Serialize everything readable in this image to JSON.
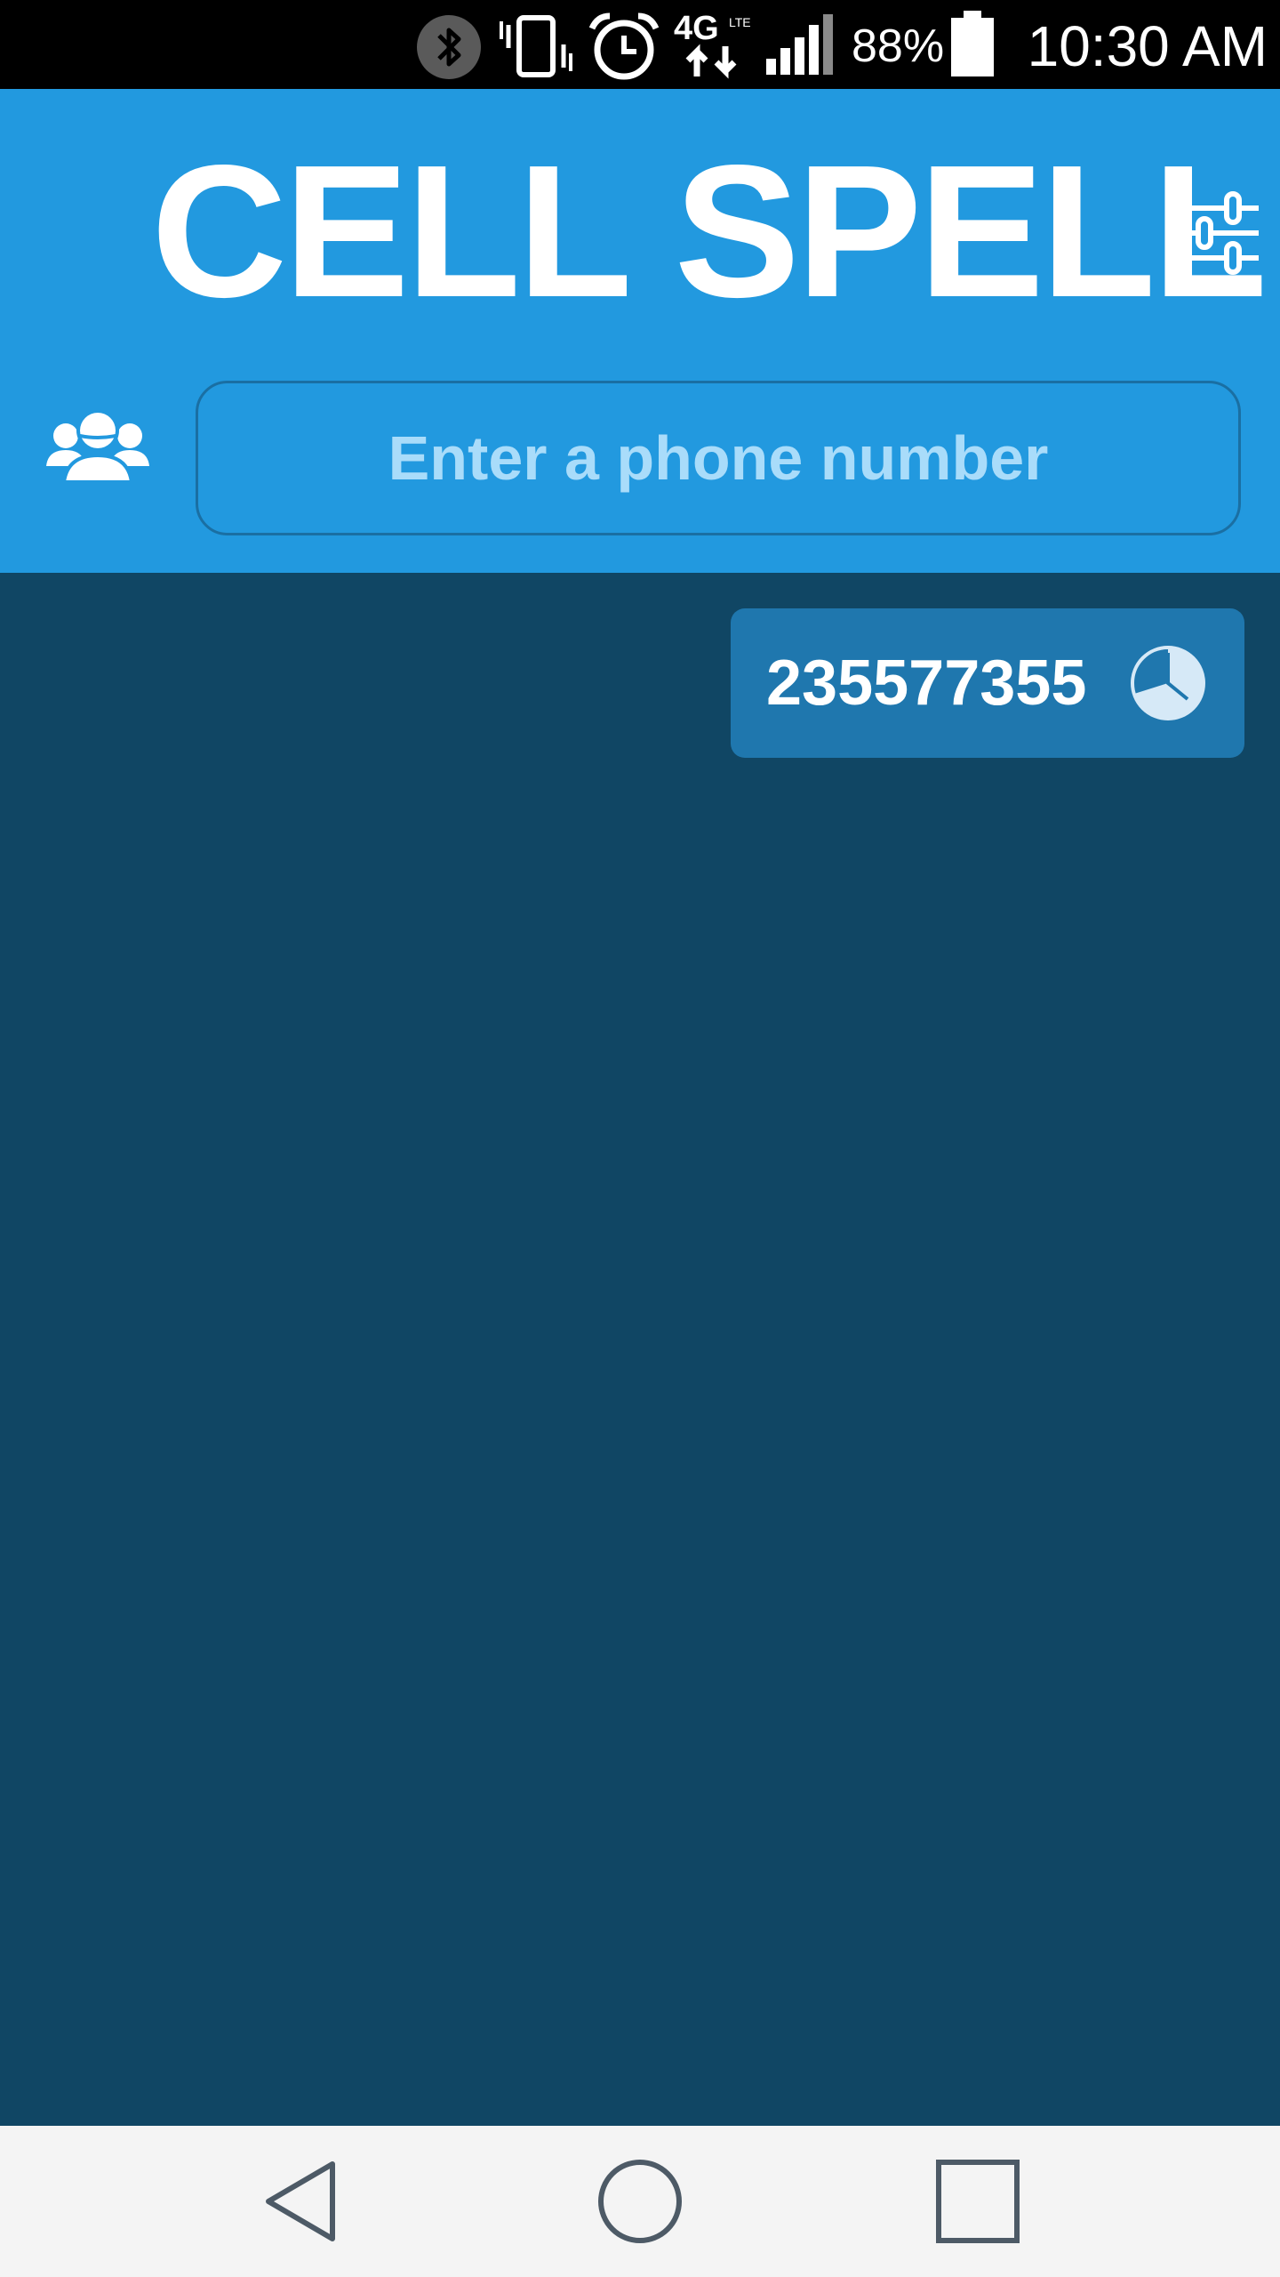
{
  "status_bar": {
    "battery_percent": "88%",
    "time": "10:30 AM",
    "network": "4G LTE",
    "icons": [
      "bluetooth-icon",
      "vibrate-icon",
      "alarm-icon",
      "network-4g-lte-icon",
      "signal-icon",
      "battery-icon"
    ]
  },
  "header": {
    "title": "CELL SPELL",
    "settings_icon": "sliders-icon",
    "contacts_icon": "contacts-group-icon"
  },
  "phone_input": {
    "value": "",
    "placeholder": "Enter a phone number"
  },
  "history": {
    "items": [
      {
        "number": "235577355",
        "icon": "history-clock-icon"
      }
    ]
  },
  "nav_bar": {
    "buttons": [
      "back-icon",
      "home-icon",
      "recents-icon"
    ]
  },
  "colors": {
    "header_blue": "#2299df",
    "body_navy": "#104664",
    "chip_blue": "#1f77ae",
    "placeholder": "#a9dcfa",
    "nav_bar": "#f4f4f4"
  }
}
